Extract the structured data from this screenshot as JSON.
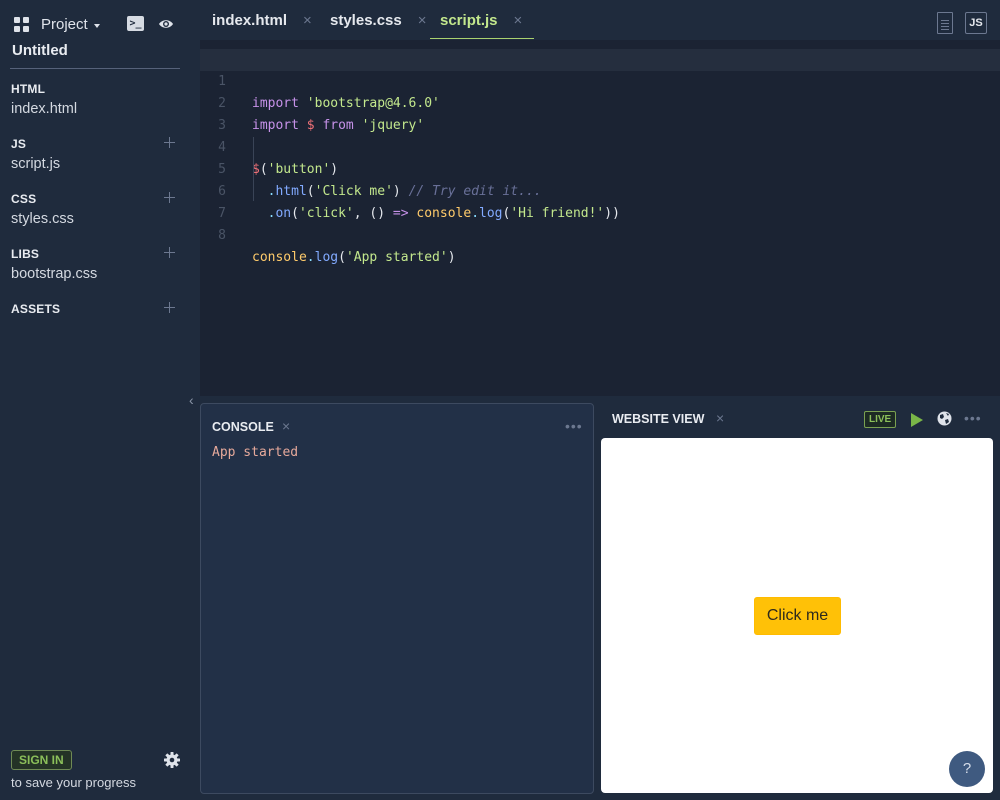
{
  "sidebar": {
    "project_label": "Project",
    "project_name": "Untitled",
    "sections": [
      {
        "heading": "HTML",
        "files": [
          "index.html"
        ],
        "addable": false
      },
      {
        "heading": "JS",
        "files": [
          "script.js"
        ],
        "addable": true
      },
      {
        "heading": "CSS",
        "files": [
          "styles.css"
        ],
        "addable": true
      },
      {
        "heading": "LIBS",
        "files": [
          "bootstrap.css"
        ],
        "addable": true
      },
      {
        "heading": "ASSETS",
        "files": [],
        "addable": true
      }
    ],
    "sign_in_label": "SIGN IN",
    "sign_in_sub": "to save your progress",
    "collapse_glyph": "‹"
  },
  "tabs": [
    {
      "label": "index.html",
      "active": false
    },
    {
      "label": "styles.css",
      "active": false
    },
    {
      "label": "script.js",
      "active": true
    }
  ],
  "tab_close_glyph": "×",
  "file_type_badge": "JS",
  "editor": {
    "line_numbers": [
      "1",
      "2",
      "3",
      "4",
      "5",
      "6",
      "7",
      "8"
    ],
    "lines": [
      "import 'bootstrap@4.6.0'",
      "import $ from 'jquery'",
      "",
      "$('button')",
      "  .html('Click me') // Try edit it...",
      "  .on('click', () => console.log('Hi friend!'))",
      "",
      "console.log('App started')"
    ],
    "highlighted_line": 1
  },
  "console": {
    "title": "CONSOLE",
    "output": [
      "App started"
    ],
    "more_glyph": "•••"
  },
  "website_view": {
    "title": "WEBSITE VIEW",
    "live_badge": "LIVE",
    "more_glyph": "•••",
    "button_label": "Click me",
    "button_color": "#ffc107"
  },
  "help_label": "?",
  "colors": {
    "accent_green": "#8bbf5a",
    "active_tab": "#c3e88d",
    "background": "#1f2b3d",
    "editor_bg": "#1b2333"
  }
}
